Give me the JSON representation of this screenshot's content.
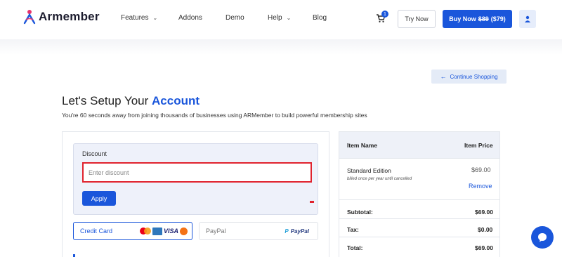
{
  "brand": {
    "name": "Armember",
    "accent": "#1a56db"
  },
  "nav": {
    "items": [
      {
        "label": "Features",
        "has_dropdown": true
      },
      {
        "label": "Addons",
        "has_dropdown": false
      },
      {
        "label": "Demo",
        "has_dropdown": false
      },
      {
        "label": "Help",
        "has_dropdown": true
      },
      {
        "label": "Blog",
        "has_dropdown": false
      }
    ],
    "cart_count": "1",
    "try_now": "Try Now",
    "buy_now_label": "Buy Now",
    "buy_now_old_price": "$89",
    "buy_now_price": "($79)"
  },
  "continue_shopping": "Continue Shopping",
  "heading": {
    "prefix": "Let's Setup Your",
    "accent": "Account"
  },
  "subheading": "You're 60 seconds away from joining thousands of businesses using ARMember to build powerful membership sites",
  "discount": {
    "label": "Discount",
    "placeholder": "Enter discount",
    "value": "",
    "apply": "Apply"
  },
  "payment": {
    "credit_card": "Credit Card",
    "visa": "VISA",
    "paypal": "PayPal",
    "paypal_logo": "PayPal"
  },
  "summary": {
    "header_name": "Item Name",
    "header_price": "Item Price",
    "item_name": "Standard Edition",
    "item_sub": "billed once per year until cancelled",
    "item_price": "$69.00",
    "remove": "Remove",
    "rows": [
      {
        "label": "Subtotal:",
        "value": "$69.00"
      },
      {
        "label": "Tax:",
        "value": "$0.00"
      },
      {
        "label": "Total:",
        "value": "$69.00"
      }
    ]
  }
}
